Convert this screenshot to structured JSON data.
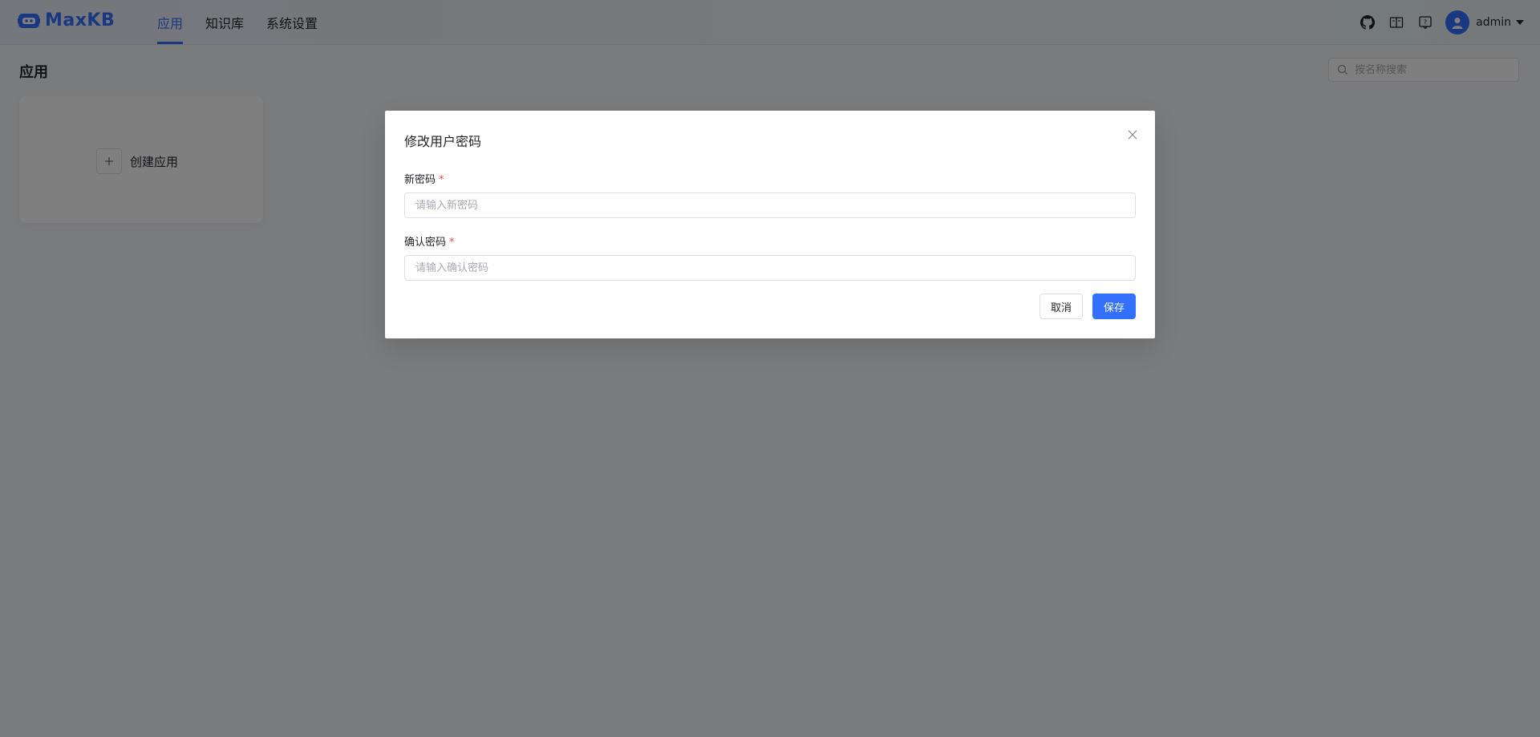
{
  "header": {
    "logo_text": "MaxKB",
    "nav": [
      {
        "label": "应用",
        "active": true
      },
      {
        "label": "知识库",
        "active": false
      },
      {
        "label": "系统设置",
        "active": false
      }
    ],
    "icons": [
      "github-icon",
      "book-icon",
      "help-icon"
    ],
    "user_name": "admin"
  },
  "main": {
    "page_title": "应用",
    "search_placeholder": "按名称搜索",
    "create_card_label": "创建应用"
  },
  "dialog": {
    "title": "修改用户密码",
    "new_password_label": "新密码",
    "new_password_placeholder": "请输入新密码",
    "confirm_password_label": "确认密码",
    "confirm_password_placeholder": "请输入确认密码",
    "required_mark": "*",
    "cancel_label": "取消",
    "save_label": "保存"
  },
  "colors": {
    "accent": "#3370ff",
    "required": "#f54a45",
    "overlay": "rgba(0,0,0,0.5)"
  }
}
